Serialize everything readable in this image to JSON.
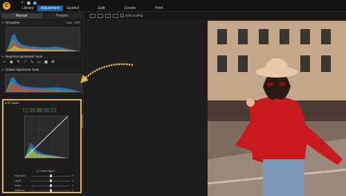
{
  "app": {
    "logo_letter": "C",
    "nav": [
      "Library",
      "Adjustment",
      "Guided",
      "Edit",
      "Create",
      "Print"
    ],
    "active_nav": "Adjustment"
  },
  "left_panel": {
    "tabs": [
      "Manual",
      "Presets"
    ],
    "histogram": {
      "title": "Histogram",
      "right_labels": [
        "Color",
        "SEP"
      ]
    },
    "regional": {
      "title": "Regional Adjustment Tools"
    },
    "global": {
      "title": "Global Adjustment Tools"
    },
    "curve": {
      "title": "Curve",
      "tonal_region": "Tonal region",
      "sliders": [
        {
          "label": "Highlights",
          "value": "0",
          "position": 0.5
        },
        {
          "label": "Lights",
          "value": "0",
          "position": 0.5
        },
        {
          "label": "Darks",
          "value": "0",
          "position": 0.5
        },
        {
          "label": "Shadows",
          "value": "0",
          "position": 0.5
        }
      ]
    }
  },
  "view_toolbar": {
    "soft_proofing": "Soft proofing"
  },
  "colors": {
    "accent": "#1f5fa8",
    "highlight": "#e8b93a",
    "sweater": "#c8191f",
    "hat": "#e6c9a6"
  }
}
